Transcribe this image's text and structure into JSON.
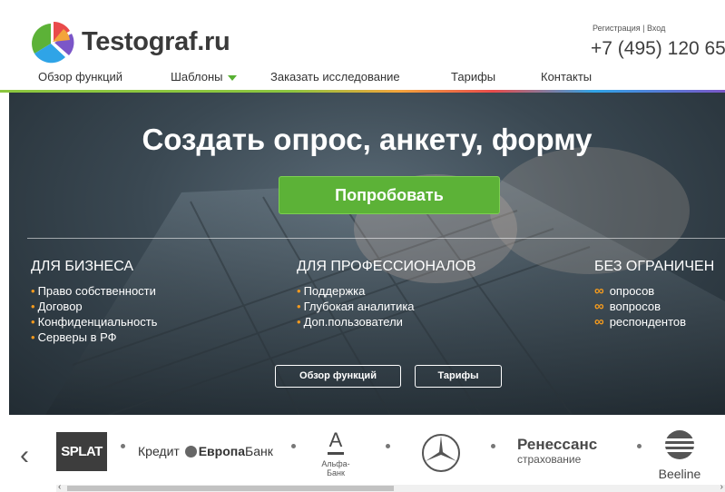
{
  "header": {
    "logo_text": "Testograf.ru",
    "register_label": "Регистрация",
    "separator": "|",
    "login_label": "Вход",
    "phone": "+7 (495) 120 65"
  },
  "nav": {
    "items": [
      {
        "label": "Обзор функций"
      },
      {
        "label": "Шаблоны"
      },
      {
        "label": "Заказать исследование"
      },
      {
        "label": "Тарифы"
      },
      {
        "label": "Контакты"
      }
    ]
  },
  "hero": {
    "title": "Создать опрос, анкету, форму",
    "try_button": "Попробовать",
    "columns": [
      {
        "title": "ДЛЯ БИЗНЕСА",
        "items": [
          "Право собственности",
          "Договор",
          "Конфиденциальность",
          "Серверы в РФ"
        ]
      },
      {
        "title": "ДЛЯ ПРОФЕССИОНАЛОВ",
        "items": [
          "Поддержка",
          "Глубокая аналитика",
          "Доп.пользователи"
        ]
      },
      {
        "title": "БЕЗ ОГРАНИЧЕН",
        "items": [
          "опросов",
          "вопросов",
          "респондентов"
        ]
      }
    ],
    "features_button": "Обзор функций",
    "tariffs_button": "Тарифы",
    "bullet": "•",
    "infinity": "∞"
  },
  "clients": {
    "splat": "SPLAT",
    "kredit_part1": "Кредит",
    "kredit_part2": "Европа",
    "kredit_part3": "Банк",
    "alfa_letter": "А",
    "alfa_name": "Альфа-Банк",
    "renaissance_main": "Ренессанс",
    "renaissance_sub": "страхование",
    "beeline": "Beeline",
    "arrow_left": "‹"
  },
  "colors": {
    "accent_green": "#5cb237",
    "bullet_orange": "#f39a1e"
  },
  "icons": {
    "logo": "testograf-pie-logo-icon",
    "caret": "caret-down-icon",
    "mercedes": "mercedes-star-icon",
    "beeline": "beeline-ball-icon"
  }
}
